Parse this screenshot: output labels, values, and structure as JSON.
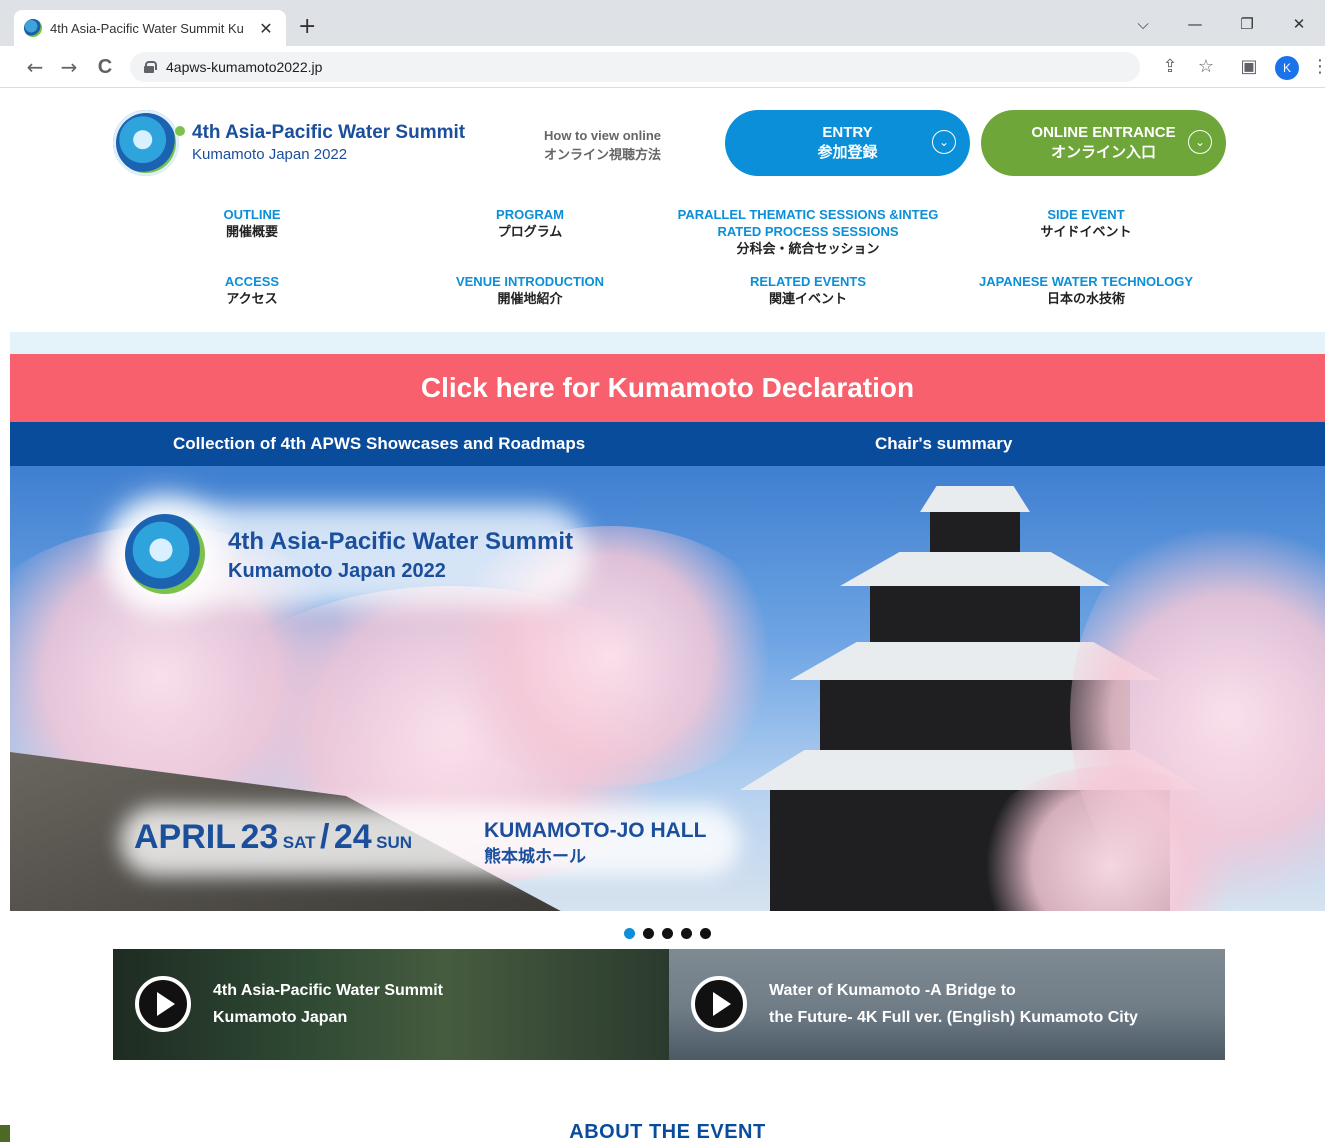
{
  "browser": {
    "tab_title": "4th Asia-Pacific Water Summit Ku",
    "tab_close": "✕",
    "new_tab": "+",
    "url": "4apws-kumamoto2022.jp",
    "profile_initial": "K",
    "icons": {
      "back": "←",
      "forward": "→",
      "reload": "C",
      "share": "⇪",
      "star": "☆",
      "sidepanel": "▣",
      "menu": "⋮",
      "dropdown": "⌵",
      "minimize": "—",
      "restore": "❐",
      "close": "✕"
    }
  },
  "header": {
    "logo_title": "4th Asia-Pacific Water Summit",
    "logo_sub": "Kumamoto Japan 2022",
    "howto_en": "How to view online",
    "howto_ja": "オンライン視聴方法",
    "entry_en": "ENTRY",
    "entry_ja": "参加登録",
    "online_en": "ONLINE ENTRANCE",
    "online_ja": "オンライン入口",
    "chevron": "⌄"
  },
  "nav": {
    "outline_en": "OUTLINE",
    "outline_ja": "開催概要",
    "program_en": "PROGRAM",
    "program_ja": "プログラム",
    "parallel_en1": "PARALLEL THEMATIC SESSIONS &INTEG",
    "parallel_en2": "RATED PROCESS SESSIONS",
    "parallel_ja": "分科会・統合セッション",
    "side_en": "SIDE EVENT",
    "side_ja": "サイドイベント",
    "access_en": "ACCESS",
    "access_ja": "アクセス",
    "venue_en": "VENUE INTRODUCTION",
    "venue_ja": "開催地紹介",
    "related_en": "RELATED EVENTS",
    "related_ja": "関連イベント",
    "tech_en": "JAPANESE WATER TECHNOLOGY",
    "tech_ja": "日本の水技術"
  },
  "banners": {
    "declaration": "Click here for Kumamoto Declaration",
    "showcases": "Collection of 4th APWS Showcases and Roadmaps",
    "chair": "Chair's summary"
  },
  "hero": {
    "title": "4th Asia-Pacific Water Summit",
    "sub": "Kumamoto Japan 2022",
    "month": "APRIL",
    "day1": "23",
    "dow1": "SAT",
    "slash": "/",
    "day2": "24",
    "dow2": "SUN",
    "venue_en": "KUMAMOTO-JO HALL",
    "venue_ja": "熊本城ホール",
    "slide_count": 5,
    "active_slide": 1
  },
  "videos": [
    {
      "line1": "4th Asia-Pacific Water Summit",
      "line2": "Kumamoto Japan"
    },
    {
      "line1": "Water of Kumamoto -A Bridge to",
      "line2": "the Future- 4K Full ver. (English) Kumamoto City"
    }
  ],
  "about_heading": "ABOUT THE EVENT"
}
